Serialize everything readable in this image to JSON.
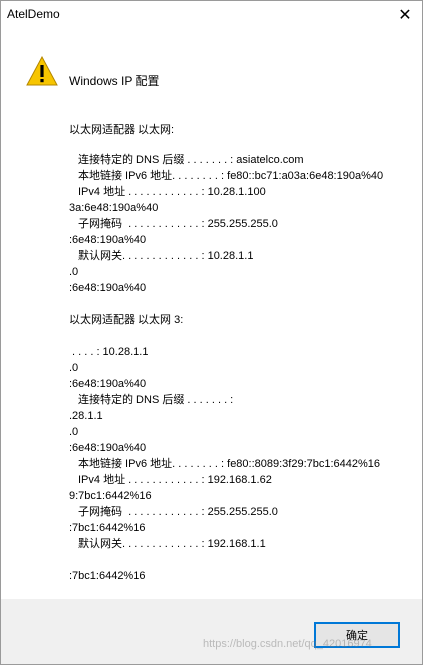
{
  "window": {
    "title": "AtelDemo",
    "close_label": "✕"
  },
  "message": {
    "heading": "Windows IP 配置",
    "icon": "warning-icon",
    "lines": [
      "以太网适配器 以太网:",
      "连接特定的 DNS 后缀 . . . . . . . : asiatelco.com",
      "本地链接 IPv6 地址. . . . . . . . : fe80::bc71:a03a:6e48:190a%40",
      "IPv4 地址 . . . . . . . . . . . . : 10.28.1.100",
      "3a:6e48:190a%40",
      "子网掩码  . . . . . . . . . . . . : 255.255.255.0",
      ":6e48:190a%40",
      "默认网关. . . . . . . . . . . . . : 10.28.1.1",
      ".0",
      ":6e48:190a%40",
      "以太网适配器 以太网 3:",
      ". . . . : 10.28.1.1",
      ".0",
      ":6e48:190a%40",
      "连接特定的 DNS 后缀 . . . . . . . :",
      ".28.1.1",
      ".0",
      ":6e48:190a%40",
      "本地链接 IPv6 地址. . . . . . . . : fe80::8089:3f29:7bc1:6442%16",
      "IPv4 地址 . . . . . . . . . . . . : 192.168.1.62",
      "9:7bc1:6442%16",
      "子网掩码  . . . . . . . . . . . . : 255.255.255.0",
      ":7bc1:6442%16",
      "默认网关. . . . . . . . . . . . . : 192.168.1.1",
      ":7bc1:6442%16"
    ]
  },
  "footer": {
    "ok_label": "确定"
  },
  "watermark": "https://blog.csdn.net/qq_42016974"
}
